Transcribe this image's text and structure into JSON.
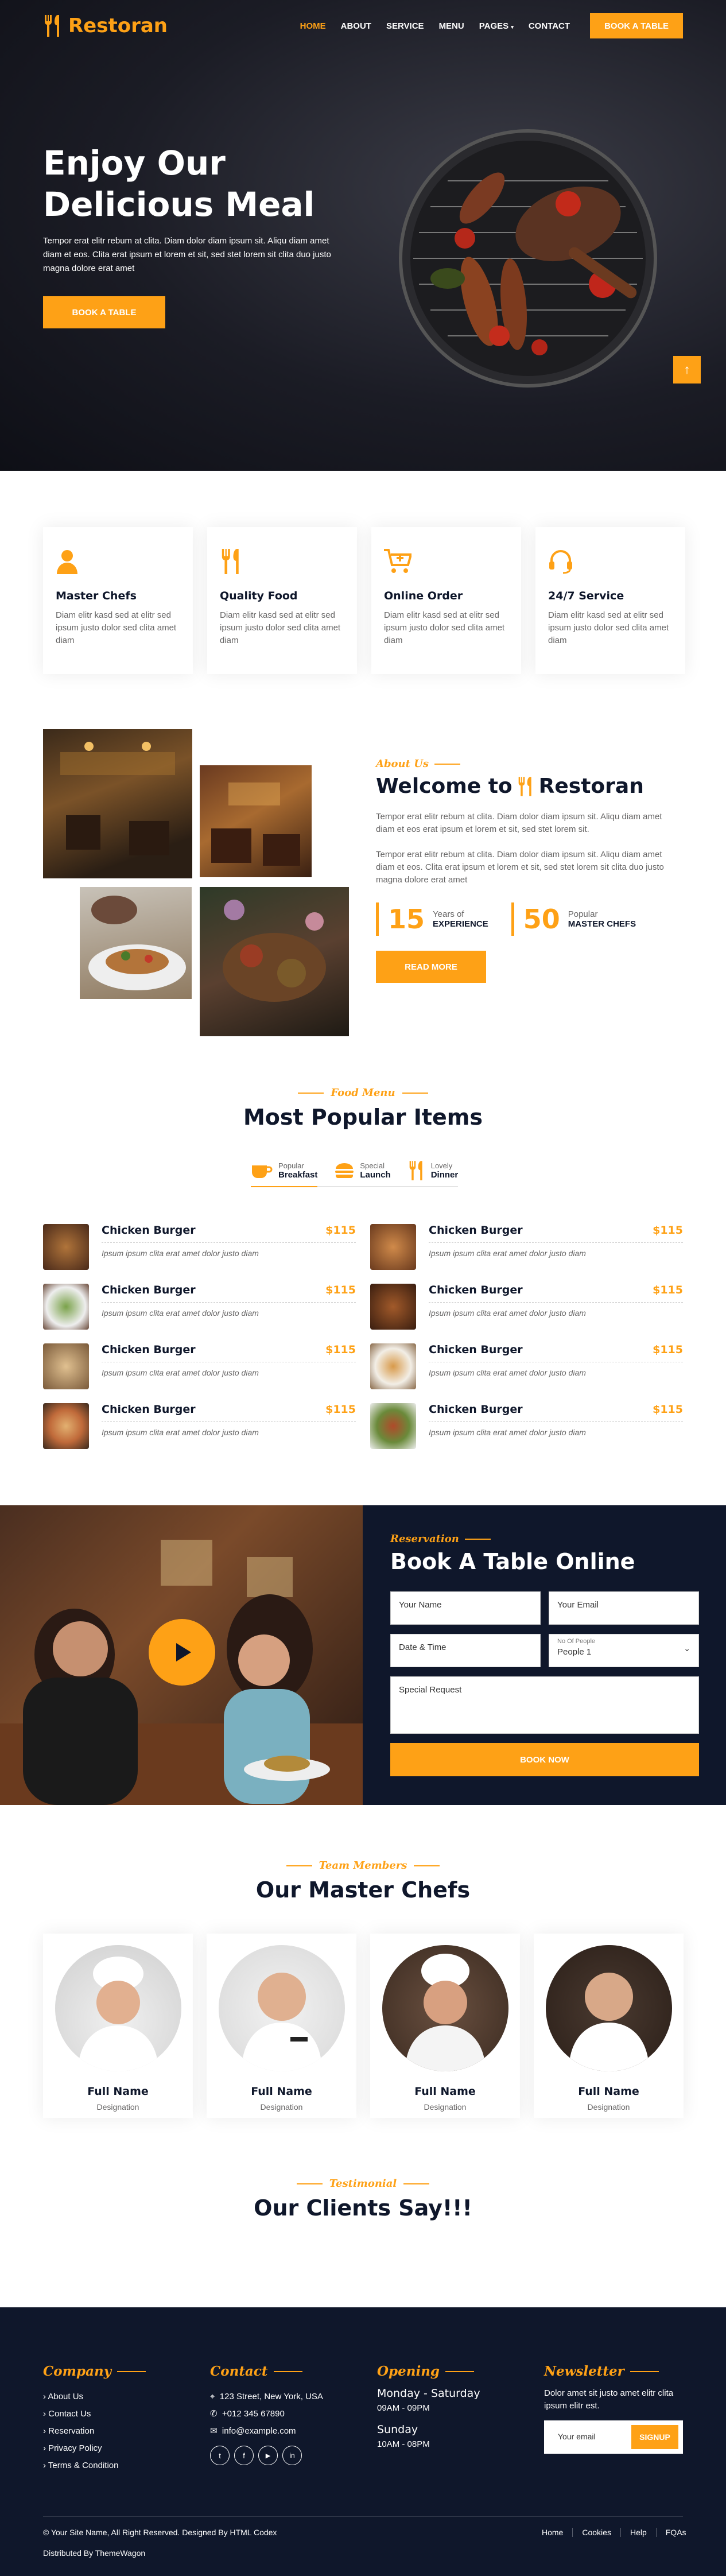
{
  "brand": {
    "name": "Restoran",
    "accent": "#fea116",
    "dark": "#0f172b"
  },
  "nav": {
    "items": [
      "HOME",
      "ABOUT",
      "SERVICE",
      "MENU",
      "PAGES",
      "CONTACT"
    ],
    "cta": "BOOK A TABLE"
  },
  "hero": {
    "title_line1": "Enjoy Our",
    "title_line2": "Delicious Meal",
    "text": "Tempor erat elitr rebum at clita. Diam dolor diam ipsum sit. Aliqu diam amet diam et eos. Clita erat ipsum et lorem et sit, sed stet lorem sit clita duo justo magna dolore erat amet",
    "button": "BOOK A TABLE"
  },
  "services": [
    {
      "title": "Master Chefs",
      "icon": "chef-icon",
      "text": "Diam elitr kasd sed at elitr sed ipsum justo dolor sed clita amet diam"
    },
    {
      "title": "Quality Food",
      "icon": "utensils-icon",
      "text": "Diam elitr kasd sed at elitr sed ipsum justo dolor sed clita amet diam"
    },
    {
      "title": "Online Order",
      "icon": "cart-icon",
      "text": "Diam elitr kasd sed at elitr sed ipsum justo dolor sed clita amet diam"
    },
    {
      "title": "24/7 Service",
      "icon": "headset-icon",
      "text": "Diam elitr kasd sed at elitr sed ipsum justo dolor sed clita amet diam"
    }
  ],
  "about": {
    "subtitle": "About Us",
    "title": "Welcome to",
    "title_brand": "Restoran",
    "p1": "Tempor erat elitr rebum at clita. Diam dolor diam ipsum sit. Aliqu diam amet diam et eos erat ipsum et lorem et sit, sed stet lorem sit.",
    "p2": "Tempor erat elitr rebum at clita. Diam dolor diam ipsum sit. Aliqu diam amet diam et eos. Clita erat ipsum et lorem et sit, sed stet lorem sit clita duo justo magna dolore erat amet",
    "stat1": {
      "num": "15",
      "top": "Years of",
      "bottom": "EXPERIENCE"
    },
    "stat2": {
      "num": "50",
      "top": "Popular",
      "bottom": "MASTER CHEFS"
    },
    "button": "READ MORE"
  },
  "menu": {
    "subtitle": "Food Menu",
    "title": "Most Popular Items",
    "tabs": [
      {
        "top": "Popular",
        "bottom": "Breakfast",
        "icon": "coffee-icon"
      },
      {
        "top": "Special",
        "bottom": "Launch",
        "icon": "burger-icon"
      },
      {
        "top": "Lovely",
        "bottom": "Dinner",
        "icon": "utensils-icon"
      }
    ],
    "items": [
      {
        "name": "Chicken Burger",
        "price": "$115",
        "desc": "Ipsum ipsum clita erat amet dolor justo diam"
      },
      {
        "name": "Chicken Burger",
        "price": "$115",
        "desc": "Ipsum ipsum clita erat amet dolor justo diam"
      },
      {
        "name": "Chicken Burger",
        "price": "$115",
        "desc": "Ipsum ipsum clita erat amet dolor justo diam"
      },
      {
        "name": "Chicken Burger",
        "price": "$115",
        "desc": "Ipsum ipsum clita erat amet dolor justo diam"
      },
      {
        "name": "Chicken Burger",
        "price": "$115",
        "desc": "Ipsum ipsum clita erat amet dolor justo diam"
      },
      {
        "name": "Chicken Burger",
        "price": "$115",
        "desc": "Ipsum ipsum clita erat amet dolor justo diam"
      },
      {
        "name": "Chicken Burger",
        "price": "$115",
        "desc": "Ipsum ipsum clita erat amet dolor justo diam"
      },
      {
        "name": "Chicken Burger",
        "price": "$115",
        "desc": "Ipsum ipsum clita erat amet dolor justo diam"
      }
    ]
  },
  "reservation": {
    "subtitle": "Reservation",
    "title": "Book A Table Online",
    "name_placeholder": "Your Name",
    "email_placeholder": "Your Email",
    "datetime_placeholder": "Date & Time",
    "people_label": "No Of People",
    "people_value": "People 1",
    "request_placeholder": "Special Request",
    "button": "BOOK NOW"
  },
  "team": {
    "subtitle": "Team Members",
    "title": "Our Master Chefs",
    "members": [
      {
        "name": "Full Name",
        "role": "Designation"
      },
      {
        "name": "Full Name",
        "role": "Designation"
      },
      {
        "name": "Full Name",
        "role": "Designation"
      },
      {
        "name": "Full Name",
        "role": "Designation"
      }
    ]
  },
  "testimonial": {
    "subtitle": "Testimonial",
    "title": "Our Clients Say!!!"
  },
  "footer": {
    "company": {
      "title": "Company",
      "links": [
        "About Us",
        "Contact Us",
        "Reservation",
        "Privacy Policy",
        "Terms & Condition"
      ]
    },
    "contact": {
      "title": "Contact",
      "address": "123 Street, New York, USA",
      "phone": "+012 345 67890",
      "email": "info@example.com"
    },
    "opening": {
      "title": "Opening",
      "d1": "Monday - Saturday",
      "h1": "09AM - 09PM",
      "d2": "Sunday",
      "h2": "10AM - 08PM"
    },
    "newsletter": {
      "title": "Newsletter",
      "text": "Dolor amet sit justo amet elitr clita ipsum elitr est.",
      "placeholder": "Your email",
      "button": "SIGNUP"
    },
    "copyright": "© Your Site Name, All Right Reserved. Designed By HTML Codex",
    "distributed": "Distributed By ThemeWagon",
    "bottom_links": [
      "Home",
      "Cookies",
      "Help",
      "FQAs"
    ]
  }
}
